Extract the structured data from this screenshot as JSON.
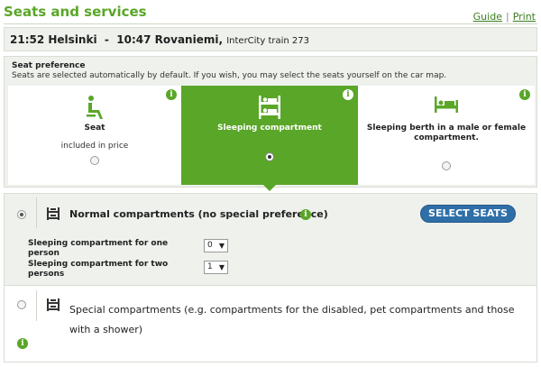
{
  "header": {
    "title": "Seats and services",
    "links": {
      "guide": "Guide",
      "separator": "|",
      "print": "Print"
    }
  },
  "train": {
    "departure": "21:52 Helsinki",
    "dash": "-",
    "arrival": "10:47 Rovaniemi,",
    "train_name": "InterCity train 273"
  },
  "seat_preference": {
    "title": "Seat preference",
    "description": "Seats are selected automatically by default. If you wish, you may select the seats yourself on the car map.",
    "options": [
      {
        "label": "Seat",
        "sublabel": "included in price",
        "icon": "seat-icon",
        "selected": false
      },
      {
        "label": "Sleeping compartment",
        "sublabel": "",
        "icon": "bunk-bed-icon",
        "selected": true
      },
      {
        "label": "Sleeping berth in a male or female compartment.",
        "sublabel": "",
        "icon": "bed-icon",
        "selected": false
      }
    ],
    "info_glyph": "i"
  },
  "compartments": {
    "normal": {
      "label": "Normal compartments (no special preference)",
      "selected": true,
      "select_button": "SELECT SEATS",
      "one_person_label": "Sleeping compartment for one person",
      "one_person_value": "0",
      "two_person_label": "Sleeping compartment for two persons",
      "two_person_value": "1",
      "select_arrow": "▼"
    },
    "special": {
      "label": "Special compartments (e.g. compartments for the disabled, pet compartments and those with a shower)",
      "selected": false
    }
  },
  "colors": {
    "accent_green": "#5aa628",
    "button_blue": "#2f6fa8",
    "panel_bg": "#eef1ec"
  }
}
